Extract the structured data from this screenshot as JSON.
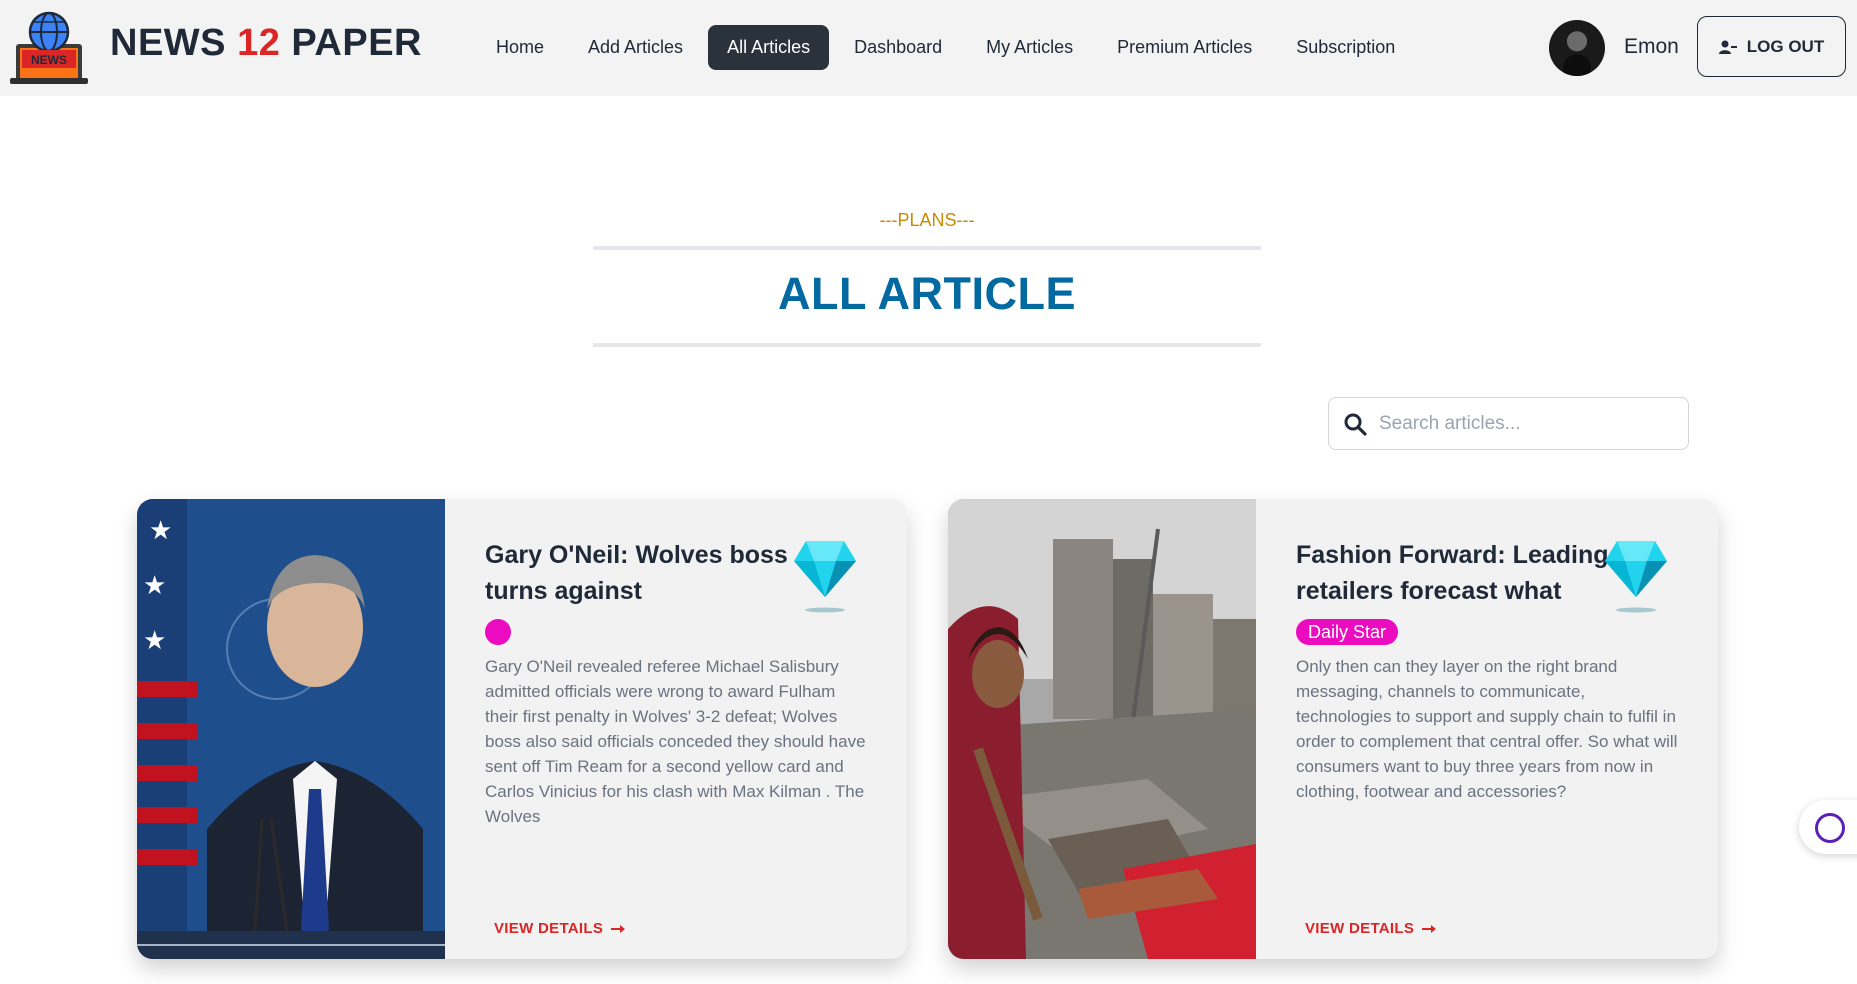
{
  "brand": {
    "part1": "NEWS ",
    "number": "12",
    "part2": " PAPER",
    "logo_text": "NEWS"
  },
  "nav": [
    {
      "label": "Home",
      "active": false
    },
    {
      "label": "Add Articles",
      "active": false
    },
    {
      "label": "All Articles",
      "active": true
    },
    {
      "label": "Dashboard",
      "active": false
    },
    {
      "label": "My Articles",
      "active": false
    },
    {
      "label": "Premium Articles",
      "active": false
    },
    {
      "label": "Subscription",
      "active": false
    }
  ],
  "user": {
    "name": "Emon",
    "logout_label": "LOG OUT"
  },
  "section": {
    "subtitle": "---PLANS---",
    "title": "ALL ARTICLE"
  },
  "search": {
    "placeholder": "Search articles...",
    "value": ""
  },
  "articles": [
    {
      "title": "Gary O'Neil: Wolves boss turns against",
      "publisher": "",
      "description": "Gary O'Neil revealed referee Michael Salisbury admitted officials were wrong to award Fulham their first penalty in Wolves' 3-2 defeat; Wolves boss also said officials conceded they should have sent off Tim Ream for a second yellow card and Carlos Vinicius for his clash with Max Kilman . The Wolves",
      "premium": true,
      "cta": "VIEW DETAILS"
    },
    {
      "title": "Fashion Forward: Leading retailers forecast what",
      "publisher": "Daily Star",
      "description": "Only then can they layer on the right brand messaging, channels to communicate, technologies to support and supply chain to fulfil in order to complement that central offer. So what will consumers want to buy three years from now in clothing, footwear and accessories?",
      "premium": true,
      "cta": "VIEW DETAILS"
    }
  ],
  "colors": {
    "accent_red": "#dc2626",
    "title_blue": "#0369a1",
    "plans_gold": "#ca8a04",
    "badge_pink": "#ec0cc0",
    "nav_active": "#2a323c"
  }
}
